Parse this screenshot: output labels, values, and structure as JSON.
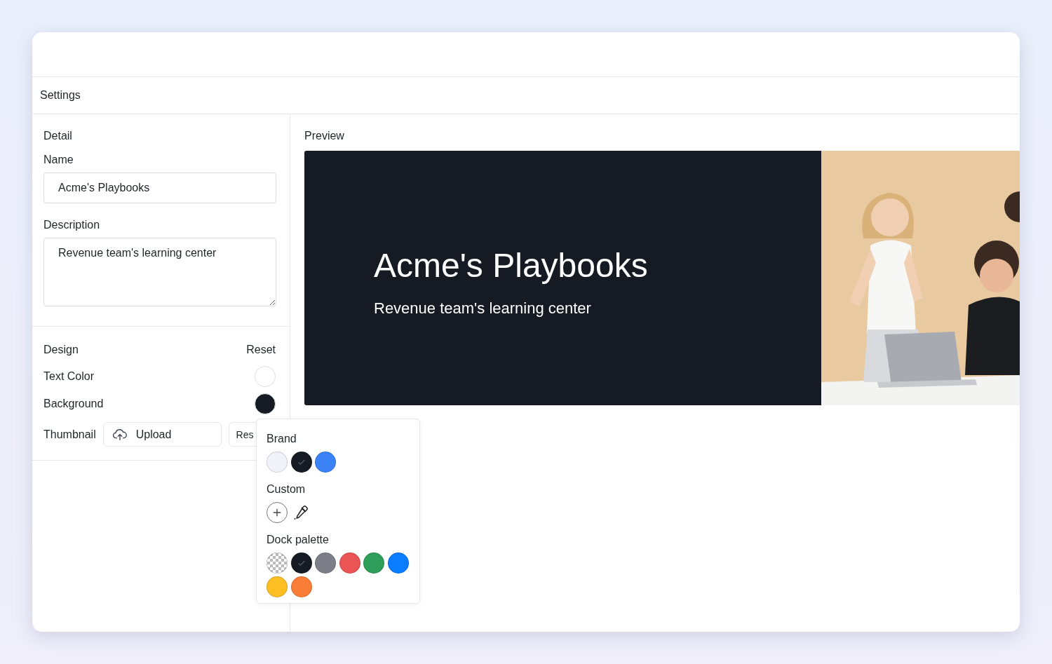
{
  "window": {
    "title": "Settings"
  },
  "detail": {
    "heading": "Detail",
    "name_label": "Name",
    "name_value": "Acme's Playbooks",
    "description_label": "Description",
    "description_value": "Revenue team's learning center"
  },
  "design": {
    "heading": "Design",
    "reset": "Reset",
    "rows": [
      {
        "label": "Text Color",
        "color": "#ffffff"
      },
      {
        "label": "Background",
        "color": "#161a22"
      }
    ],
    "thumbnail": {
      "label": "Thumbnail",
      "upload": "Upload",
      "reset": "Res"
    }
  },
  "color_popover": {
    "sections": [
      {
        "title": "Brand",
        "kind": "swatches",
        "swatches": [
          {
            "kind": "color",
            "color": "#f1f2fa",
            "selected": false
          },
          {
            "kind": "color",
            "color": "#161a22",
            "selected": true
          },
          {
            "kind": "color",
            "color": "#3b82f6",
            "selected": false
          }
        ]
      },
      {
        "title": "Custom",
        "kind": "custom"
      },
      {
        "title": "Dock palette",
        "kind": "swatches",
        "swatches": [
          {
            "kind": "transparent",
            "selected": false
          },
          {
            "kind": "color",
            "color": "#161a22",
            "selected": true
          },
          {
            "kind": "color",
            "color": "#7c7f87",
            "selected": false
          },
          {
            "kind": "color",
            "color": "#ea5455",
            "selected": false
          },
          {
            "kind": "color",
            "color": "#2f9e5b",
            "selected": false
          },
          {
            "kind": "color",
            "color": "#0a7cff",
            "selected": false
          },
          {
            "kind": "color",
            "color": "#fbbf24",
            "selected": false
          },
          {
            "kind": "color",
            "color": "#f97d36",
            "selected": false
          }
        ]
      }
    ]
  },
  "preview": {
    "label": "Preview",
    "title": "Acme's Playbooks",
    "subtitle": "Revenue team's learning center"
  }
}
